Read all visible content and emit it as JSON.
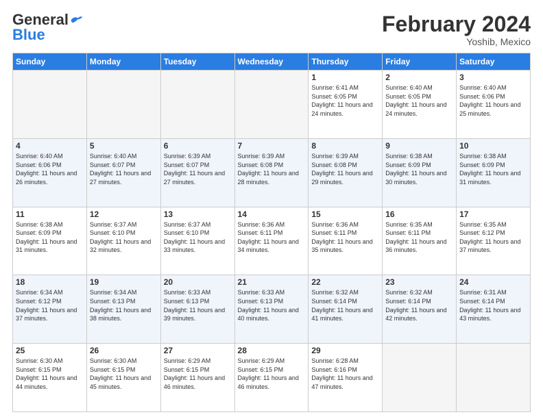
{
  "header": {
    "logo_general": "General",
    "logo_blue": "Blue",
    "month_title": "February 2024",
    "location": "Yoshib, Mexico"
  },
  "days_of_week": [
    "Sunday",
    "Monday",
    "Tuesday",
    "Wednesday",
    "Thursday",
    "Friday",
    "Saturday"
  ],
  "weeks": [
    [
      {
        "day": "",
        "info": ""
      },
      {
        "day": "",
        "info": ""
      },
      {
        "day": "",
        "info": ""
      },
      {
        "day": "",
        "info": ""
      },
      {
        "day": "1",
        "info": "Sunrise: 6:41 AM\nSunset: 6:05 PM\nDaylight: 11 hours and 24 minutes."
      },
      {
        "day": "2",
        "info": "Sunrise: 6:40 AM\nSunset: 6:05 PM\nDaylight: 11 hours and 24 minutes."
      },
      {
        "day": "3",
        "info": "Sunrise: 6:40 AM\nSunset: 6:06 PM\nDaylight: 11 hours and 25 minutes."
      }
    ],
    [
      {
        "day": "4",
        "info": "Sunrise: 6:40 AM\nSunset: 6:06 PM\nDaylight: 11 hours and 26 minutes."
      },
      {
        "day": "5",
        "info": "Sunrise: 6:40 AM\nSunset: 6:07 PM\nDaylight: 11 hours and 27 minutes."
      },
      {
        "day": "6",
        "info": "Sunrise: 6:39 AM\nSunset: 6:07 PM\nDaylight: 11 hours and 27 minutes."
      },
      {
        "day": "7",
        "info": "Sunrise: 6:39 AM\nSunset: 6:08 PM\nDaylight: 11 hours and 28 minutes."
      },
      {
        "day": "8",
        "info": "Sunrise: 6:39 AM\nSunset: 6:08 PM\nDaylight: 11 hours and 29 minutes."
      },
      {
        "day": "9",
        "info": "Sunrise: 6:38 AM\nSunset: 6:09 PM\nDaylight: 11 hours and 30 minutes."
      },
      {
        "day": "10",
        "info": "Sunrise: 6:38 AM\nSunset: 6:09 PM\nDaylight: 11 hours and 31 minutes."
      }
    ],
    [
      {
        "day": "11",
        "info": "Sunrise: 6:38 AM\nSunset: 6:09 PM\nDaylight: 11 hours and 31 minutes."
      },
      {
        "day": "12",
        "info": "Sunrise: 6:37 AM\nSunset: 6:10 PM\nDaylight: 11 hours and 32 minutes."
      },
      {
        "day": "13",
        "info": "Sunrise: 6:37 AM\nSunset: 6:10 PM\nDaylight: 11 hours and 33 minutes."
      },
      {
        "day": "14",
        "info": "Sunrise: 6:36 AM\nSunset: 6:11 PM\nDaylight: 11 hours and 34 minutes."
      },
      {
        "day": "15",
        "info": "Sunrise: 6:36 AM\nSunset: 6:11 PM\nDaylight: 11 hours and 35 minutes."
      },
      {
        "day": "16",
        "info": "Sunrise: 6:35 AM\nSunset: 6:11 PM\nDaylight: 11 hours and 36 minutes."
      },
      {
        "day": "17",
        "info": "Sunrise: 6:35 AM\nSunset: 6:12 PM\nDaylight: 11 hours and 37 minutes."
      }
    ],
    [
      {
        "day": "18",
        "info": "Sunrise: 6:34 AM\nSunset: 6:12 PM\nDaylight: 11 hours and 37 minutes."
      },
      {
        "day": "19",
        "info": "Sunrise: 6:34 AM\nSunset: 6:13 PM\nDaylight: 11 hours and 38 minutes."
      },
      {
        "day": "20",
        "info": "Sunrise: 6:33 AM\nSunset: 6:13 PM\nDaylight: 11 hours and 39 minutes."
      },
      {
        "day": "21",
        "info": "Sunrise: 6:33 AM\nSunset: 6:13 PM\nDaylight: 11 hours and 40 minutes."
      },
      {
        "day": "22",
        "info": "Sunrise: 6:32 AM\nSunset: 6:14 PM\nDaylight: 11 hours and 41 minutes."
      },
      {
        "day": "23",
        "info": "Sunrise: 6:32 AM\nSunset: 6:14 PM\nDaylight: 11 hours and 42 minutes."
      },
      {
        "day": "24",
        "info": "Sunrise: 6:31 AM\nSunset: 6:14 PM\nDaylight: 11 hours and 43 minutes."
      }
    ],
    [
      {
        "day": "25",
        "info": "Sunrise: 6:30 AM\nSunset: 6:15 PM\nDaylight: 11 hours and 44 minutes."
      },
      {
        "day": "26",
        "info": "Sunrise: 6:30 AM\nSunset: 6:15 PM\nDaylight: 11 hours and 45 minutes."
      },
      {
        "day": "27",
        "info": "Sunrise: 6:29 AM\nSunset: 6:15 PM\nDaylight: 11 hours and 46 minutes."
      },
      {
        "day": "28",
        "info": "Sunrise: 6:29 AM\nSunset: 6:15 PM\nDaylight: 11 hours and 46 minutes."
      },
      {
        "day": "29",
        "info": "Sunrise: 6:28 AM\nSunset: 6:16 PM\nDaylight: 11 hours and 47 minutes."
      },
      {
        "day": "",
        "info": ""
      },
      {
        "day": "",
        "info": ""
      }
    ]
  ]
}
